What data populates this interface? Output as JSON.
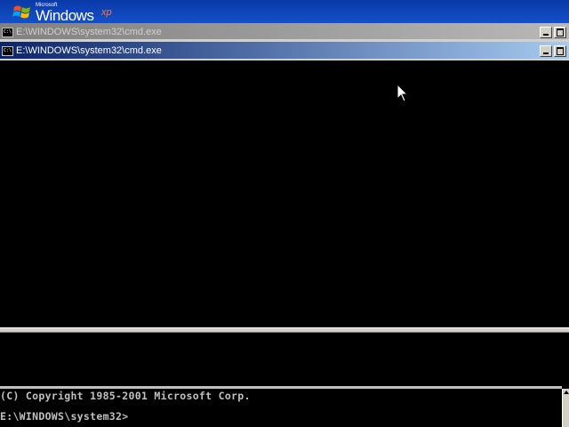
{
  "desktop": {
    "logo": {
      "ms_text": "Microsoft",
      "windows_text": "Windows",
      "xp_text": "xp"
    }
  },
  "background_window": {
    "title": "E:\\WINDOWS\\system32\\cmd.exe",
    "console_lines": [
      "(C) Copyright 1985-2001 Microsoft Corp.",
      "E:\\WINDOWS\\system32>"
    ]
  },
  "foreground_window": {
    "title": "E:\\WINDOWS\\system32\\cmd.exe"
  },
  "icons": {
    "window_icon": "cmd-icon",
    "minimize": "minimize-icon",
    "maximize": "maximize-icon",
    "cursor": "mouse-pointer-icon"
  },
  "colors": {
    "active_title_start": "#0a246a",
    "active_title_end": "#a6caf0",
    "inactive_title_start": "#808080",
    "inactive_title_end": "#b8b8b8",
    "console_bg": "#000000",
    "console_text": "#c0c0c0"
  }
}
